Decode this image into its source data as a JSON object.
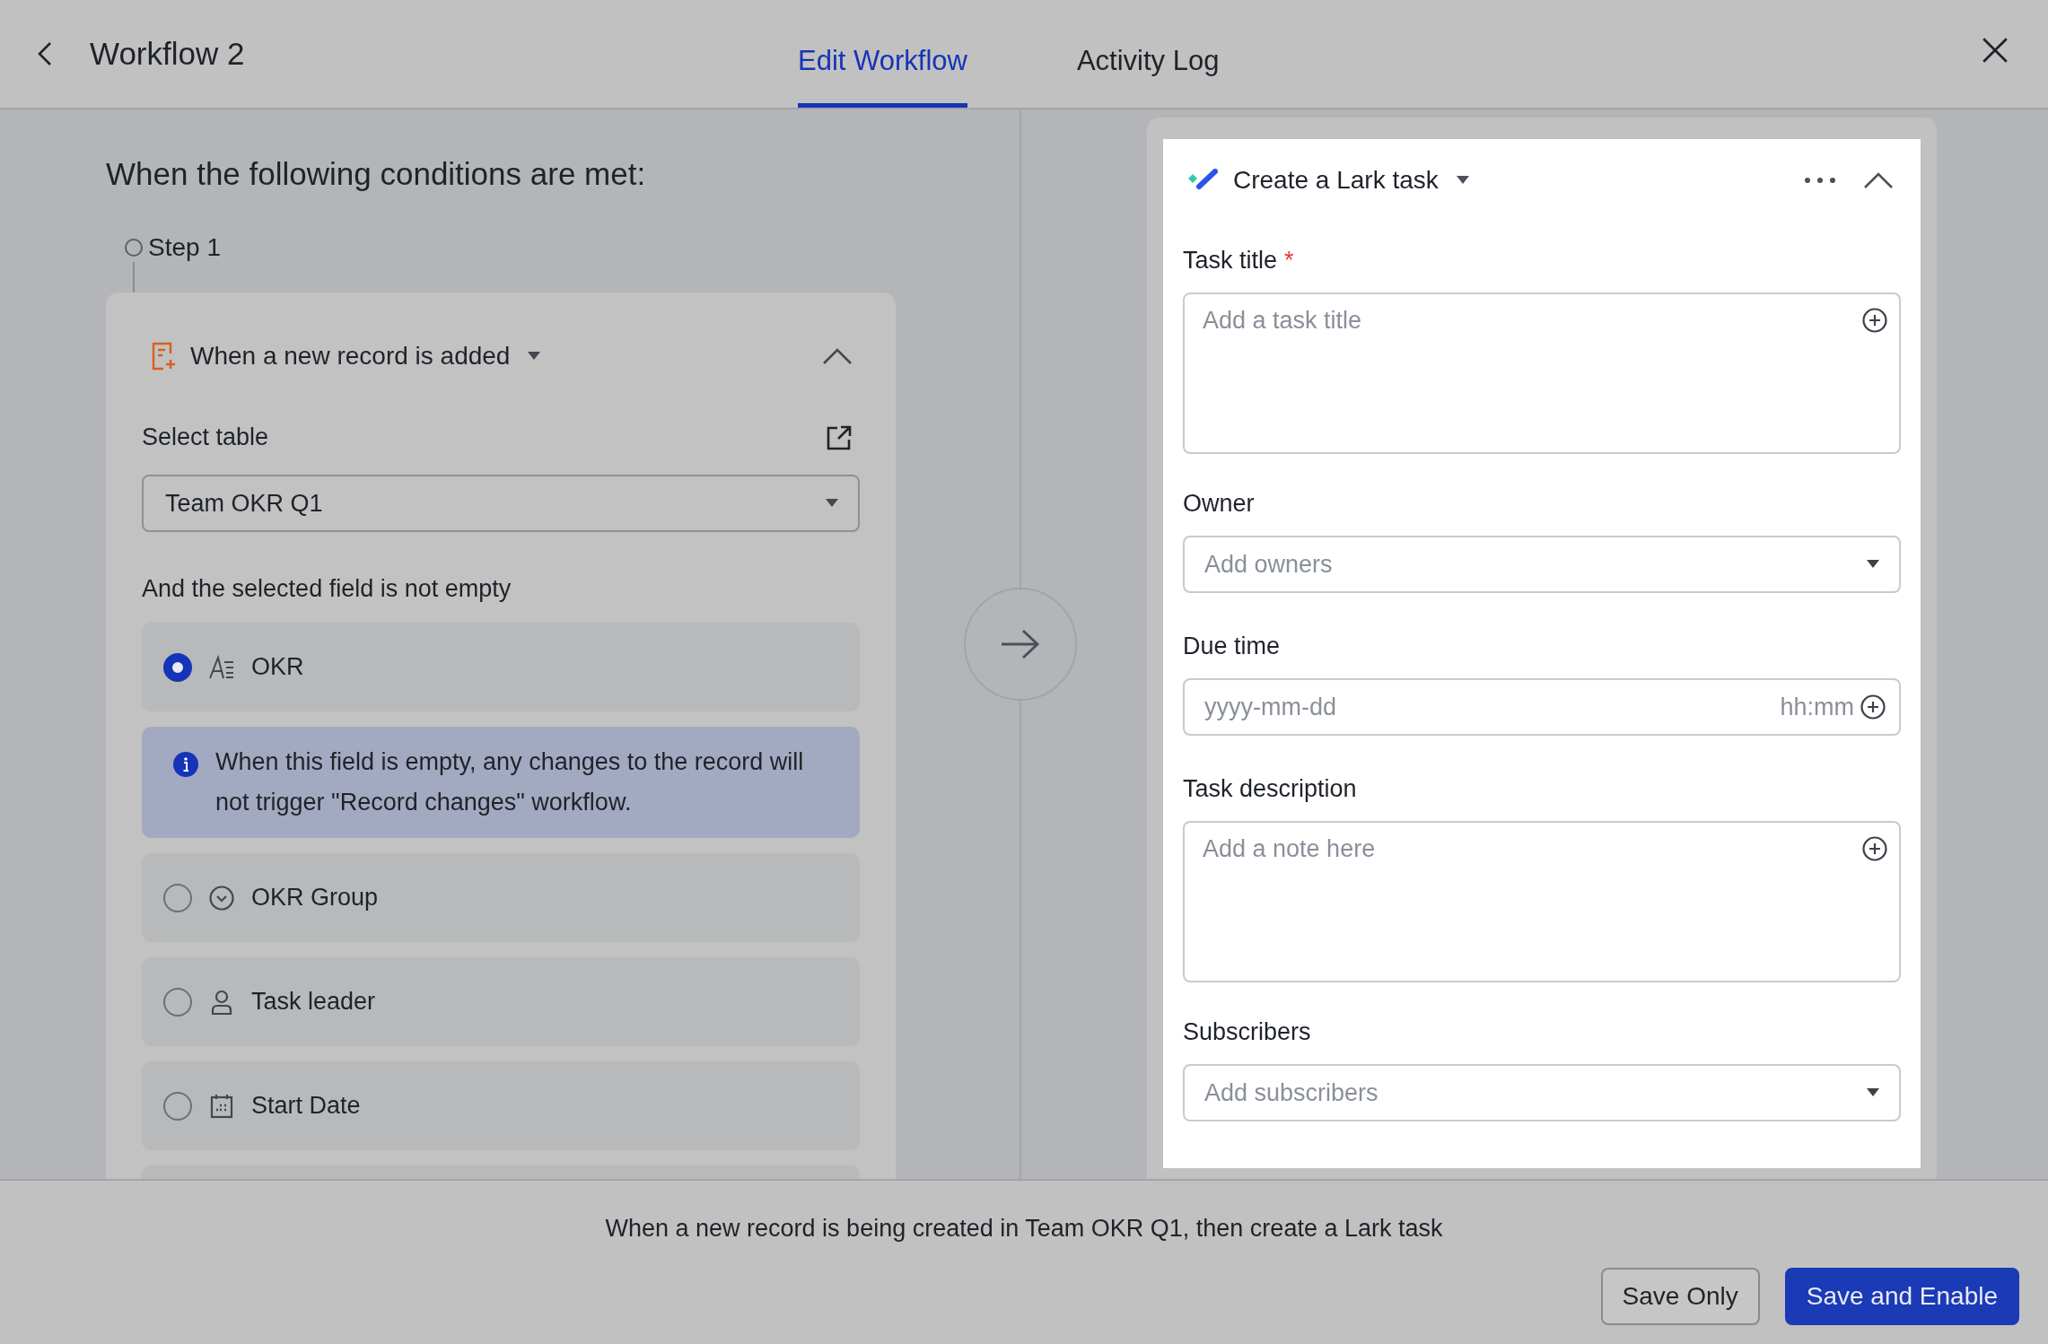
{
  "header": {
    "title": "Workflow 2",
    "tabs": [
      {
        "label": "Edit Workflow",
        "selected": true
      },
      {
        "label": "Activity Log",
        "selected": false
      }
    ]
  },
  "trigger": {
    "heading": "When the following conditions are met:",
    "step": "Step 1",
    "card": {
      "title": "When a new record is added",
      "expanded": true,
      "table_label": "Select table",
      "table_value": "Team OKR Q1",
      "fields_label": "And the selected field is not empty",
      "fields": [
        {
          "name": "OKR",
          "kind": "text",
          "selected": true,
          "note": "When this field is empty, any changes to the record will not trigger \"Record changes\" workflow."
        },
        {
          "name": "OKR Group",
          "kind": "option",
          "selected": false
        },
        {
          "name": "Task leader",
          "kind": "person",
          "selected": false
        },
        {
          "name": "Start Date",
          "kind": "date",
          "selected": false
        }
      ]
    }
  },
  "action": {
    "title": "Create a Lark task",
    "expanded": true,
    "fields": [
      {
        "label": "Task title",
        "required_mark": "*",
        "kind": "textarea",
        "placeholder": "Add a task title"
      },
      {
        "label": "Owner",
        "kind": "select",
        "placeholder": "Add owners"
      },
      {
        "label": "Due time",
        "kind": "datetime",
        "placeholder": "yyyy-mm-dd",
        "time_placeholder": "hh:mm"
      },
      {
        "label": "Task description",
        "kind": "textarea",
        "placeholder": "Add a note here"
      },
      {
        "label": "Subscribers",
        "kind": "select",
        "placeholder": "Add subscribers"
      }
    ]
  },
  "footer": {
    "summary": "When a new record is being created in Team OKR Q1, then create a Lark task",
    "buttons": [
      {
        "label": "Save Only",
        "kind": "secondary"
      },
      {
        "label": "Save and Enable",
        "kind": "primary"
      }
    ]
  }
}
